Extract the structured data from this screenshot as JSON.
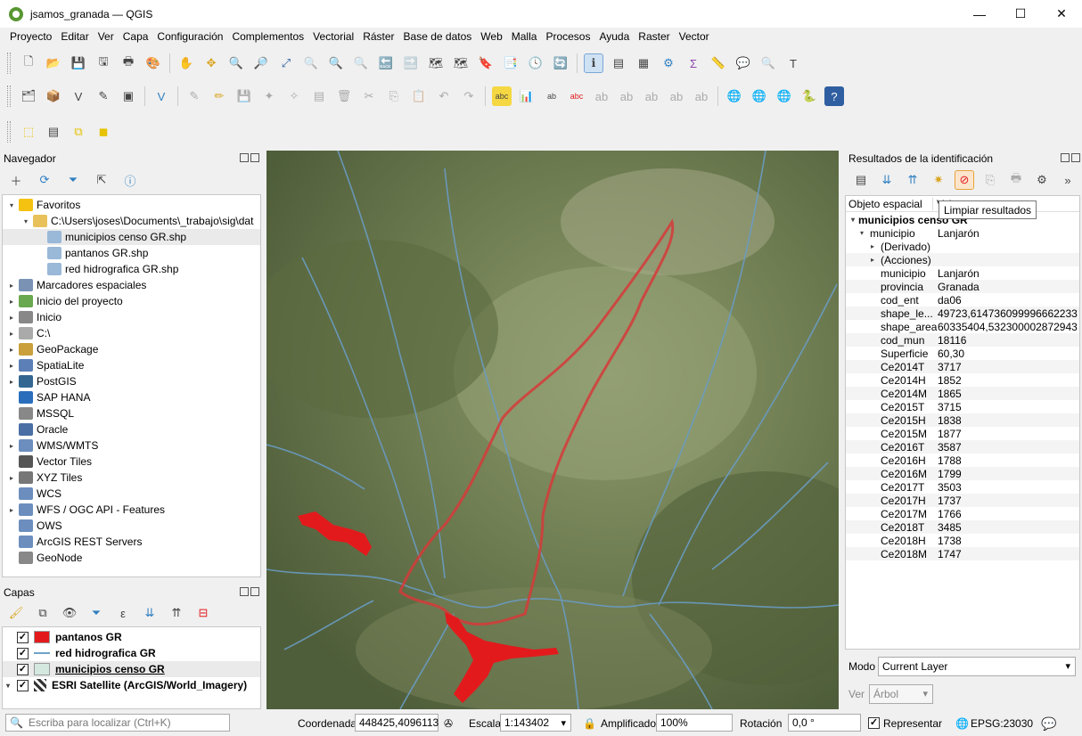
{
  "window": {
    "title": "jsamos_granada — QGIS",
    "minimize": "—",
    "maximize": "☐",
    "close": "✕"
  },
  "menu": [
    "Proyecto",
    "Editar",
    "Ver",
    "Capa",
    "Configuración",
    "Complementos",
    "Vectorial",
    "Ráster",
    "Base de datos",
    "Web",
    "Malla",
    "Procesos",
    "Ayuda",
    "Raster",
    "Vector"
  ],
  "browser": {
    "title": "Navegador",
    "items": [
      {
        "label": "Favoritos",
        "indent": 0,
        "arrow": "▾",
        "icon": "star-icon",
        "color": "#f5c211"
      },
      {
        "label": "C:\\Users\\joses\\Documents\\_trabajo\\sig\\dat",
        "indent": 1,
        "arrow": "▾",
        "icon": "folder-icon",
        "color": "#e8c15a"
      },
      {
        "label": "municipios censo GR.shp",
        "indent": 2,
        "arrow": "",
        "icon": "polygon-layer-icon",
        "color": "#9ab8d8",
        "selected": true
      },
      {
        "label": "pantanos GR.shp",
        "indent": 2,
        "arrow": "",
        "icon": "polygon-layer-icon",
        "color": "#9ab8d8"
      },
      {
        "label": "red hidrografica GR.shp",
        "indent": 2,
        "arrow": "",
        "icon": "polygon-layer-icon",
        "color": "#9ab8d8"
      },
      {
        "label": "Marcadores espaciales",
        "indent": 0,
        "arrow": "▸",
        "icon": "bookmark-icon",
        "color": "#7a93b5"
      },
      {
        "label": "Inicio del proyecto",
        "indent": 0,
        "arrow": "▸",
        "icon": "project-home-icon",
        "color": "#6aa84f"
      },
      {
        "label": "Inicio",
        "indent": 0,
        "arrow": "▸",
        "icon": "home-icon",
        "color": "#888"
      },
      {
        "label": "C:\\",
        "indent": 0,
        "arrow": "▸",
        "icon": "drive-icon",
        "color": "#aaa"
      },
      {
        "label": "GeoPackage",
        "indent": 0,
        "arrow": "▸",
        "icon": "geopackage-icon",
        "color": "#c9a03b"
      },
      {
        "label": "SpatiaLite",
        "indent": 0,
        "arrow": "▸",
        "icon": "spatialite-icon",
        "color": "#5b7fb6"
      },
      {
        "label": "PostGIS",
        "indent": 0,
        "arrow": "▸",
        "icon": "postgis-icon",
        "color": "#336791"
      },
      {
        "label": "SAP HANA",
        "indent": 0,
        "arrow": "",
        "icon": "sap-hana-icon",
        "color": "#2a6ebb"
      },
      {
        "label": "MSSQL",
        "indent": 0,
        "arrow": "",
        "icon": "mssql-icon",
        "color": "#888"
      },
      {
        "label": "Oracle",
        "indent": 0,
        "arrow": "",
        "icon": "oracle-icon",
        "color": "#4a6fa5"
      },
      {
        "label": "WMS/WMTS",
        "indent": 0,
        "arrow": "▸",
        "icon": "wms-icon",
        "color": "#6c8ebf"
      },
      {
        "label": "Vector Tiles",
        "indent": 0,
        "arrow": "",
        "icon": "vector-tiles-icon",
        "color": "#555"
      },
      {
        "label": "XYZ Tiles",
        "indent": 0,
        "arrow": "▸",
        "icon": "xyz-tiles-icon",
        "color": "#777"
      },
      {
        "label": "WCS",
        "indent": 0,
        "arrow": "",
        "icon": "wcs-icon",
        "color": "#6c8ebf"
      },
      {
        "label": "WFS / OGC API - Features",
        "indent": 0,
        "arrow": "▸",
        "icon": "wfs-icon",
        "color": "#6c8ebf"
      },
      {
        "label": "OWS",
        "indent": 0,
        "arrow": "",
        "icon": "ows-icon",
        "color": "#6c8ebf"
      },
      {
        "label": "ArcGIS REST Servers",
        "indent": 0,
        "arrow": "",
        "icon": "arcgis-icon",
        "color": "#6c8ebf"
      },
      {
        "label": "GeoNode",
        "indent": 0,
        "arrow": "",
        "icon": "geonode-icon",
        "color": "#888"
      }
    ]
  },
  "layers": {
    "title": "Capas",
    "items": [
      {
        "label": "pantanos GR",
        "checked": "✓",
        "swatch": "#e31a1c",
        "kind": "fill"
      },
      {
        "label": "red hidrografica GR",
        "checked": "✓",
        "swatch": "#6fa3c7",
        "kind": "line"
      },
      {
        "label": "municipios censo GR",
        "checked": "✓",
        "swatch": "#d5e8e0",
        "kind": "fill",
        "underline": true
      },
      {
        "label": "ESRI Satellite (ArcGIS/World_Imagery)",
        "checked": "✓",
        "swatch": "#3b4a5a",
        "kind": "raster",
        "arrow": "▾"
      }
    ]
  },
  "identify": {
    "title": "Resultados de la identificación",
    "col_feature": "Objeto espacial",
    "col_value": "Valor",
    "tooltip": "Limpiar resultados",
    "layer_name": "municipios censo GR",
    "feature_key": "municipio",
    "feature_value": "Lanjarón",
    "derived": "(Derivado)",
    "actions": "(Acciones)",
    "attributes": [
      [
        "municipio",
        "Lanjarón"
      ],
      [
        "provincia",
        "Granada"
      ],
      [
        "cod_ent",
        "da06"
      ],
      [
        "shape_le...",
        "49723,6147360999966622330..."
      ],
      [
        "shape_area",
        "60335404,5323000028729438..."
      ],
      [
        "cod_mun",
        "18116"
      ],
      [
        "Superficie",
        "60,30"
      ],
      [
        "Ce2014T",
        "3717"
      ],
      [
        "Ce2014H",
        "1852"
      ],
      [
        "Ce2014M",
        "1865"
      ],
      [
        "Ce2015T",
        "3715"
      ],
      [
        "Ce2015H",
        "1838"
      ],
      [
        "Ce2015M",
        "1877"
      ],
      [
        "Ce2016T",
        "3587"
      ],
      [
        "Ce2016H",
        "1788"
      ],
      [
        "Ce2016M",
        "1799"
      ],
      [
        "Ce2017T",
        "3503"
      ],
      [
        "Ce2017H",
        "1737"
      ],
      [
        "Ce2017M",
        "1766"
      ],
      [
        "Ce2018T",
        "3485"
      ],
      [
        "Ce2018H",
        "1738"
      ],
      [
        "Ce2018M",
        "1747"
      ]
    ],
    "mode_label": "Modo",
    "mode_value": "Current Layer",
    "view_label": "Ver",
    "view_value": "Árbol"
  },
  "status": {
    "search_placeholder": "Escriba para localizar (Ctrl+K)",
    "coord_label": "Coordenada",
    "coord_value": "448425,4096113",
    "scale_label": "Escala",
    "scale_value": "1:143402",
    "magnifier_label": "Amplificador",
    "magnifier_value": "100%",
    "rotation_label": "Rotación",
    "rotation_value": "0,0 °",
    "render_label": "Representar",
    "render_checked": "✓",
    "crs": "EPSG:23030"
  }
}
